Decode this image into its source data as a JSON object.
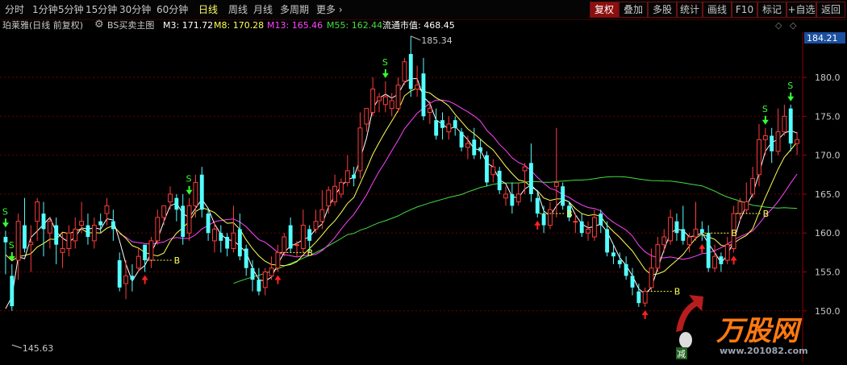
{
  "toolbar": {
    "periods": [
      "分时",
      "1分钟",
      "5分钟",
      "15分钟",
      "30分钟",
      "60分钟",
      "日线",
      "周线",
      "月线",
      "多周期",
      "更多"
    ],
    "active_period": "日线",
    "more_arrow": "›",
    "right_buttons": [
      "复权",
      "叠加",
      "多股",
      "统计",
      "画线",
      "F10",
      "标记",
      "+自选",
      "返回"
    ],
    "active_right": "复权"
  },
  "infobar": {
    "stock": "珀莱雅(日线 前复权)",
    "indicator": "BS买卖主图",
    "ma3": "M3: 171.72",
    "ma8": "M8: 170.28",
    "ma13": "M13: 165.46",
    "ma55": "M55: 162.44",
    "market_value": "流通市值: 468.45",
    "gear_icon": "settings-icon",
    "diamond_icon": "diamond-icon"
  },
  "colors": {
    "up": "#ff3c3c",
    "down": "#54ffff",
    "ma3": "#ffffff",
    "ma8": "#ffff55",
    "ma13": "#ff44ff",
    "ma55": "#44dd44",
    "grid": "#6b0000"
  },
  "price_axis": {
    "current": "184.21",
    "ticks": [
      "180.0",
      "175.0",
      "170.0",
      "165.0",
      "160.0",
      "155.0",
      "150.0"
    ],
    "high_label": "185.34",
    "low_label": "145.63"
  },
  "markers": {
    "buy_letter": "B",
    "sell_letter": "S"
  },
  "watermark": {
    "brand": "万股网",
    "url": "www.201082.com",
    "small_tag": "减"
  },
  "chart_data": {
    "type": "candlestick",
    "y_range": [
      145,
      186
    ],
    "candles": [
      [
        159.5,
        158.8,
        160.3,
        154.7
      ],
      [
        154.5,
        150.6,
        156.0,
        150.0
      ],
      [
        156.5,
        161.5,
        162.5,
        154.0
      ],
      [
        161.0,
        158.0,
        164.5,
        157.5
      ],
      [
        158.5,
        158.8,
        161.0,
        155.0
      ],
      [
        161.5,
        164.0,
        164.5,
        159.0
      ],
      [
        162.5,
        160.5,
        164.0,
        157.0
      ],
      [
        160.0,
        161.5,
        162.0,
        158.0
      ],
      [
        161.0,
        158.5,
        162.0,
        156.0
      ],
      [
        157.5,
        158.0,
        160.0,
        155.5
      ],
      [
        158.0,
        160.0,
        161.0,
        157.0
      ],
      [
        159.0,
        160.5,
        162.0,
        158.0
      ],
      [
        161.0,
        161.5,
        164.0,
        160.0
      ],
      [
        161.0,
        159.5,
        162.5,
        158.5
      ],
      [
        159.0,
        161.0,
        162.0,
        158.0
      ],
      [
        161.5,
        161.0,
        162.5,
        160.0
      ],
      [
        162.5,
        163.5,
        164.5,
        161.0
      ],
      [
        161.5,
        160.5,
        163.0,
        159.0
      ],
      [
        156.5,
        153.0,
        157.5,
        152.5
      ],
      [
        153.5,
        154.5,
        156.5,
        151.5
      ],
      [
        154.5,
        154.0,
        156.0,
        152.5
      ],
      [
        155.5,
        157.0,
        158.0,
        155.0
      ],
      [
        158.5,
        156.5,
        158.5,
        155.0
      ],
      [
        156.5,
        159.0,
        159.5,
        155.5
      ],
      [
        159.0,
        162.0,
        163.0,
        158.5
      ],
      [
        162.0,
        163.5,
        163.5,
        161.0
      ],
      [
        164.0,
        165.0,
        166.0,
        163.0
      ],
      [
        164.5,
        163.0,
        165.0,
        161.5
      ],
      [
        163.5,
        159.5,
        165.0,
        158.5
      ],
      [
        160.0,
        163.5,
        164.5,
        159.0
      ],
      [
        163.5,
        166.5,
        167.5,
        162.0
      ],
      [
        167.5,
        163.0,
        168.5,
        162.0
      ],
      [
        162.5,
        160.0,
        163.0,
        159.0
      ],
      [
        159.0,
        160.5,
        161.5,
        157.5
      ],
      [
        160.0,
        159.0,
        161.0,
        157.5
      ],
      [
        159.5,
        158.0,
        160.0,
        157.0
      ],
      [
        158.0,
        160.0,
        163.5,
        157.5
      ],
      [
        160.5,
        157.0,
        162.5,
        156.5
      ],
      [
        158.0,
        155.5,
        158.5,
        154.5
      ],
      [
        155.5,
        154.0,
        156.5,
        152.5
      ],
      [
        154.0,
        152.5,
        155.5,
        152.0
      ],
      [
        153.0,
        155.0,
        155.5,
        152.0
      ],
      [
        154.5,
        155.5,
        157.0,
        154.0
      ],
      [
        155.5,
        157.5,
        158.5,
        155.0
      ],
      [
        157.5,
        159.5,
        160.0,
        157.0
      ],
      [
        161.0,
        158.0,
        162.0,
        157.5
      ],
      [
        158.5,
        158.5,
        159.0,
        157.0
      ],
      [
        158.0,
        161.0,
        163.0,
        157.5
      ],
      [
        160.5,
        159.0,
        161.0,
        157.5
      ],
      [
        160.5,
        161.5,
        163.0,
        160.0
      ],
      [
        161.5,
        163.0,
        165.5,
        160.5
      ],
      [
        163.5,
        165.5,
        166.0,
        162.5
      ],
      [
        164.0,
        166.0,
        167.5,
        163.5
      ],
      [
        165.0,
        166.5,
        167.0,
        164.5
      ],
      [
        166.5,
        168.0,
        170.0,
        166.0
      ],
      [
        167.5,
        167.0,
        168.5,
        166.0
      ],
      [
        168.0,
        173.5,
        175.5,
        167.0
      ],
      [
        174.0,
        176.0,
        176.0,
        173.0
      ],
      [
        175.5,
        178.5,
        180.0,
        175.0
      ],
      [
        177.0,
        177.5,
        178.0,
        175.5
      ],
      [
        176.5,
        177.5,
        179.5,
        175.5
      ],
      [
        176.0,
        177.0,
        178.0,
        175.0
      ],
      [
        176.0,
        179.0,
        180.0,
        175.5
      ],
      [
        179.5,
        182.0,
        182.5,
        179.0
      ],
      [
        183.0,
        178.5,
        185.3,
        177.5
      ],
      [
        178.5,
        179.0,
        181.5,
        177.5
      ],
      [
        180.5,
        175.0,
        182.5,
        174.5
      ],
      [
        175.5,
        176.0,
        177.0,
        174.0
      ],
      [
        174.5,
        172.5,
        176.0,
        172.0
      ],
      [
        174.5,
        173.5,
        175.5,
        172.0
      ],
      [
        173.0,
        174.0,
        175.0,
        172.0
      ],
      [
        174.5,
        173.5,
        175.0,
        172.5
      ],
      [
        173.0,
        171.0,
        173.5,
        170.5
      ],
      [
        171.0,
        171.5,
        172.5,
        169.5
      ],
      [
        172.0,
        170.0,
        173.5,
        169.5
      ],
      [
        171.0,
        170.5,
        172.0,
        169.5
      ],
      [
        170.0,
        166.5,
        170.5,
        166.0
      ],
      [
        167.5,
        168.5,
        169.5,
        166.5
      ],
      [
        168.0,
        165.5,
        168.5,
        165.0
      ],
      [
        164.5,
        165.0,
        166.0,
        163.5
      ],
      [
        165.0,
        163.5,
        166.5,
        162.5
      ],
      [
        164.0,
        165.0,
        166.5,
        163.5
      ],
      [
        168.0,
        168.5,
        169.0,
        165.0
      ],
      [
        169.0,
        165.0,
        171.5,
        164.0
      ],
      [
        164.5,
        162.5,
        165.5,
        162.0
      ],
      [
        162.5,
        161.0,
        163.5,
        160.0
      ],
      [
        161.0,
        163.0,
        164.0,
        160.5
      ],
      [
        166.0,
        166.5,
        173.5,
        162.0
      ],
      [
        166.0,
        163.5,
        166.5,
        163.0
      ],
      [
        163.5,
        162.0,
        164.0,
        161.5
      ],
      [
        161.5,
        161.5,
        162.5,
        160.0
      ],
      [
        161.5,
        160.0,
        162.5,
        159.5
      ],
      [
        160.0,
        160.5,
        161.5,
        159.0
      ],
      [
        159.5,
        162.0,
        163.0,
        159.0
      ],
      [
        162.5,
        161.0,
        163.0,
        160.0
      ],
      [
        160.5,
        157.5,
        161.5,
        157.0
      ],
      [
        157.5,
        157.0,
        158.5,
        156.0
      ],
      [
        156.5,
        156.0,
        157.5,
        155.5
      ],
      [
        156.0,
        154.5,
        157.0,
        154.0
      ],
      [
        154.5,
        153.0,
        155.5,
        152.0
      ],
      [
        152.5,
        151.0,
        153.5,
        150.5
      ],
      [
        151.0,
        152.5,
        153.0,
        150.5
      ],
      [
        153.0,
        155.5,
        158.0,
        152.5
      ],
      [
        155.5,
        158.5,
        159.5,
        155.0
      ],
      [
        158.5,
        159.5,
        160.5,
        157.5
      ],
      [
        159.0,
        162.0,
        163.0,
        158.5
      ],
      [
        161.5,
        160.0,
        162.5,
        159.0
      ],
      [
        160.5,
        159.0,
        163.5,
        158.5
      ],
      [
        158.5,
        159.5,
        160.0,
        157.5
      ],
      [
        159.5,
        160.5,
        164.0,
        159.0
      ],
      [
        160.5,
        160.0,
        161.5,
        159.0
      ],
      [
        160.0,
        155.5,
        161.0,
        155.0
      ],
      [
        155.5,
        157.0,
        158.5,
        155.0
      ],
      [
        157.0,
        156.0,
        157.5,
        155.0
      ],
      [
        156.5,
        158.5,
        159.5,
        156.0
      ],
      [
        158.0,
        162.5,
        163.5,
        157.5
      ],
      [
        162.5,
        164.0,
        164.5,
        161.5
      ],
      [
        163.0,
        164.0,
        166.5,
        162.5
      ],
      [
        165.0,
        167.0,
        168.5,
        164.5
      ],
      [
        167.5,
        172.0,
        174.0,
        166.0
      ],
      [
        172.0,
        172.5,
        173.5,
        170.0
      ],
      [
        172.5,
        170.5,
        173.5,
        169.0
      ],
      [
        170.5,
        173.0,
        176.0,
        170.0
      ],
      [
        173.0,
        175.0,
        176.5,
        172.5
      ],
      [
        176.0,
        171.5,
        176.5,
        170.5
      ],
      [
        171.5,
        172.0,
        173.0,
        170.0
      ]
    ],
    "signals": [
      {
        "type": "S",
        "index": 0
      },
      {
        "type": "S",
        "index": 1
      },
      {
        "type": "S",
        "index": 29
      },
      {
        "type": "S",
        "index": 60
      },
      {
        "type": "S",
        "index": 120
      },
      {
        "type": "S",
        "index": 124
      },
      {
        "type": "B",
        "index": 22
      },
      {
        "type": "B",
        "index": 43
      },
      {
        "type": "B",
        "index": 84
      },
      {
        "type": "B",
        "index": 101
      },
      {
        "type": "B",
        "index": 110
      },
      {
        "type": "B",
        "index": 115
      }
    ]
  }
}
